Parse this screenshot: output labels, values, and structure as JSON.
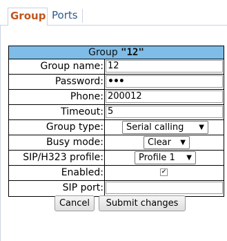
{
  "tabs": [
    {
      "label": "Group",
      "active": true
    },
    {
      "label": "Ports",
      "active": false
    }
  ],
  "form": {
    "title_prefix": "Group ",
    "title_value": "\"12\"",
    "header_color": "#7fbce7",
    "fields": {
      "group_name": {
        "label": "Group name:",
        "value": "12"
      },
      "password": {
        "label": "Password:",
        "value": "•••"
      },
      "phone": {
        "label": "Phone:",
        "value": "200012"
      },
      "timeout": {
        "label": "Timeout:",
        "value": "5"
      },
      "group_type": {
        "label": "Group type:",
        "value": "Serial calling"
      },
      "busy_mode": {
        "label": "Busy mode:",
        "value": "Clear"
      },
      "sip_profile": {
        "label": "SIP/H323 profile:",
        "value": "Profile 1"
      },
      "enabled": {
        "label": "Enabled:",
        "checked": true
      },
      "sip_port": {
        "label": "SIP port:",
        "value": ""
      }
    }
  },
  "buttons": {
    "cancel": "Cancel",
    "submit": "Submit changes"
  },
  "icons": {
    "dropdown": "chevron-down-icon",
    "check": "checkmark-icon"
  }
}
